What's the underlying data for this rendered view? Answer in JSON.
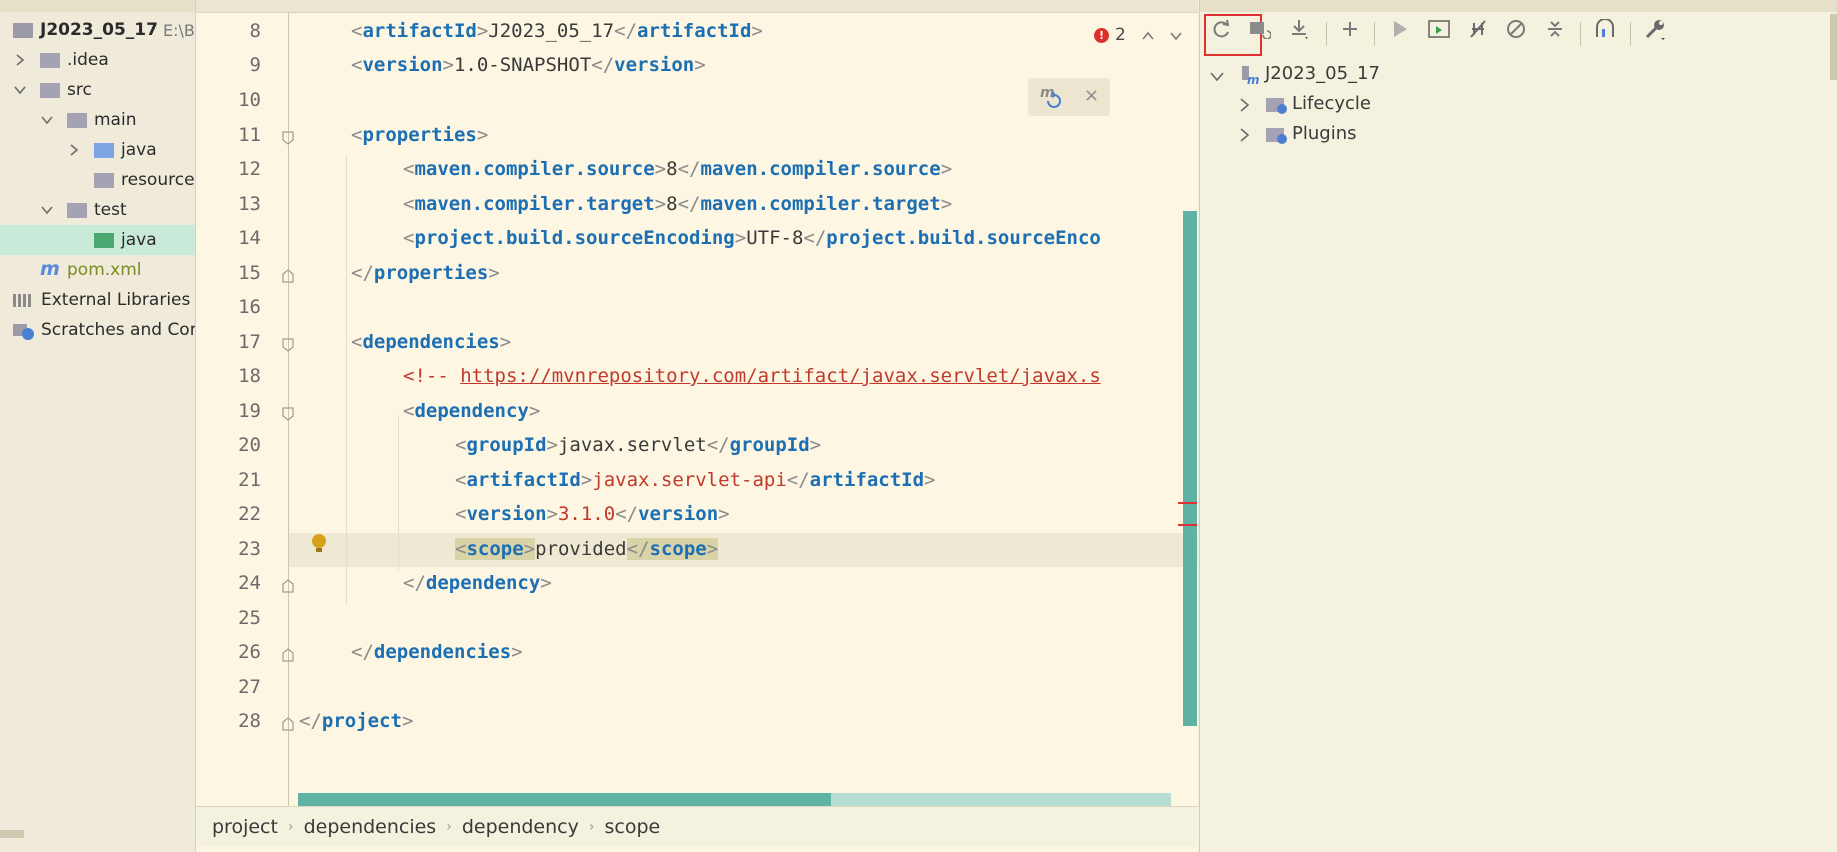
{
  "project_tree": {
    "root": {
      "name": "J2023_05_17",
      "path": "E:\\B"
    },
    "items": [
      {
        "label": ".idea"
      },
      {
        "label": "src"
      },
      {
        "label": "main"
      },
      {
        "label": "java"
      },
      {
        "label": "resource"
      },
      {
        "label": "test"
      },
      {
        "label": "java"
      },
      {
        "label": "pom.xml"
      },
      {
        "label": "External Libraries"
      },
      {
        "label": "Scratches and Cor"
      }
    ]
  },
  "editor": {
    "error_count": "2",
    "lines": [
      {
        "num": "8"
      },
      {
        "num": "9"
      },
      {
        "num": "10"
      },
      {
        "num": "11"
      },
      {
        "num": "12"
      },
      {
        "num": "13"
      },
      {
        "num": "14"
      },
      {
        "num": "15"
      },
      {
        "num": "16"
      },
      {
        "num": "17"
      },
      {
        "num": "18"
      },
      {
        "num": "19"
      },
      {
        "num": "20"
      },
      {
        "num": "21"
      },
      {
        "num": "22"
      },
      {
        "num": "23"
      },
      {
        "num": "24"
      },
      {
        "num": "25"
      },
      {
        "num": "26"
      },
      {
        "num": "27"
      },
      {
        "num": "28"
      }
    ],
    "code": {
      "artifactId_tag": "artifactId",
      "artifactId_value": "J2023_05_17",
      "version_tag": "version",
      "version_value": "1.0-SNAPSHOT",
      "properties_tag": "properties",
      "source_tag": "maven.compiler.source",
      "source_value": "8",
      "target_tag": "maven.compiler.target",
      "target_value": "8",
      "encoding_tag": "project.build.sourceEncoding",
      "encoding_value": "UTF-8",
      "encoding_close_tag": "project.build.sourceEnco",
      "dependencies_tag": "dependencies",
      "comment_open": "<!-- ",
      "comment_url": "https://mvnrepository.com/artifact/javax.servlet/javax.s",
      "dependency_tag": "dependency",
      "groupId_tag": "groupId",
      "groupId_value": "javax.servlet",
      "artifactId2_value": "javax.servlet-api",
      "version2_value": "3.1.0",
      "scope_tag": "scope",
      "scope_value": "provided",
      "project_tag": "project"
    }
  },
  "breadcrumb": [
    "project",
    "dependencies",
    "dependency",
    "scope"
  ],
  "maven": {
    "project": "J2023_05_17",
    "nodes": [
      {
        "label": "Lifecycle"
      },
      {
        "label": "Plugins"
      }
    ]
  },
  "colors": {
    "accent_teal": "#5fb3a5",
    "highlight_red": "#e03030",
    "tag_blue": "#1c6fb3"
  }
}
